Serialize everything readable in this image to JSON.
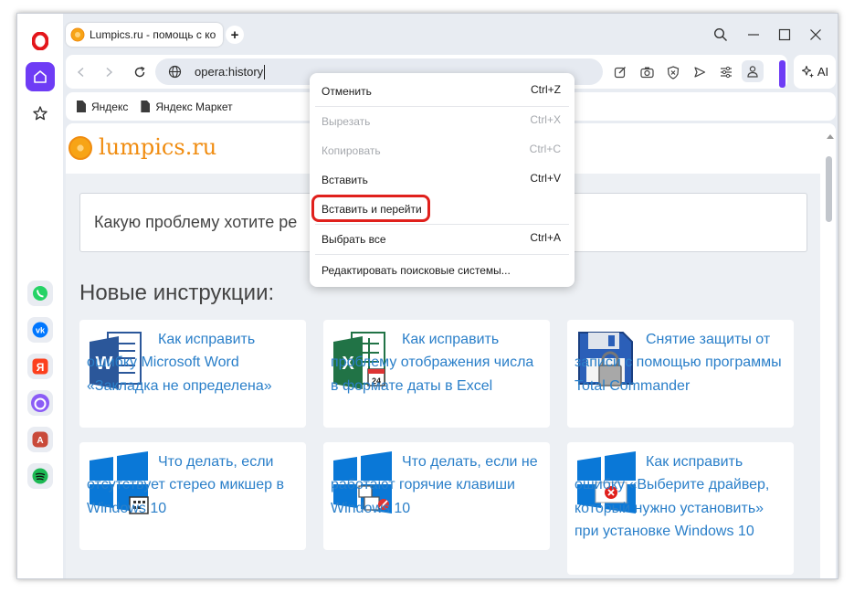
{
  "browser": {
    "tab_title": "Lumpics.ru - помощь с ко",
    "url": "opera:history",
    "ai_label": "AI"
  },
  "bookmarks": [
    "Яндекс",
    "Яндекс Маркет"
  ],
  "site": {
    "logo": "lumpics.ru",
    "search_placeholder": "Какую проблему хотите ре",
    "section_title": "Новые инструкции:"
  },
  "cards": [
    {
      "text": "Как исправить ошибку Microsoft Word «Закладка не определена»",
      "icon": "word-icon"
    },
    {
      "text": "Как исправить проблему отображения числа в формате даты в Excel",
      "icon": "excel-icon"
    },
    {
      "text": "Снятие защиты от записи с помощью программы Total Commander",
      "icon": "floppy-lock-icon"
    },
    {
      "text": "Что делать, если отсутствует стерео микшер в Windows 10",
      "icon": "windows-icon"
    },
    {
      "text": "Что делать, если не работают горячие клавиши Windows 10",
      "icon": "windows-icon"
    },
    {
      "text": "Как исправить ошибку «Выберите драйвер, который нужно установить» при установке Windows 10",
      "icon": "windows-error-icon"
    }
  ],
  "context_menu": {
    "items": [
      {
        "label": "Отменить",
        "shortcut": "Ctrl+Z",
        "disabled": false
      },
      {
        "label": "Вырезать",
        "shortcut": "Ctrl+X",
        "disabled": true
      },
      {
        "label": "Копировать",
        "shortcut": "Ctrl+C",
        "disabled": true
      },
      {
        "label": "Вставить",
        "shortcut": "Ctrl+V",
        "disabled": false
      },
      {
        "label": "Вставить и перейти",
        "shortcut": "",
        "disabled": false
      },
      {
        "label": "Выбрать все",
        "shortcut": "Ctrl+A",
        "disabled": false
      },
      {
        "label": "Редактировать поисковые системы...",
        "shortcut": "",
        "disabled": false
      }
    ],
    "highlighted": "Вставить и перейти"
  },
  "colors": {
    "accent": "#6e3cf5",
    "logo": "#f08c10",
    "link": "#2a7fc9",
    "highlight": "#e0201c"
  }
}
